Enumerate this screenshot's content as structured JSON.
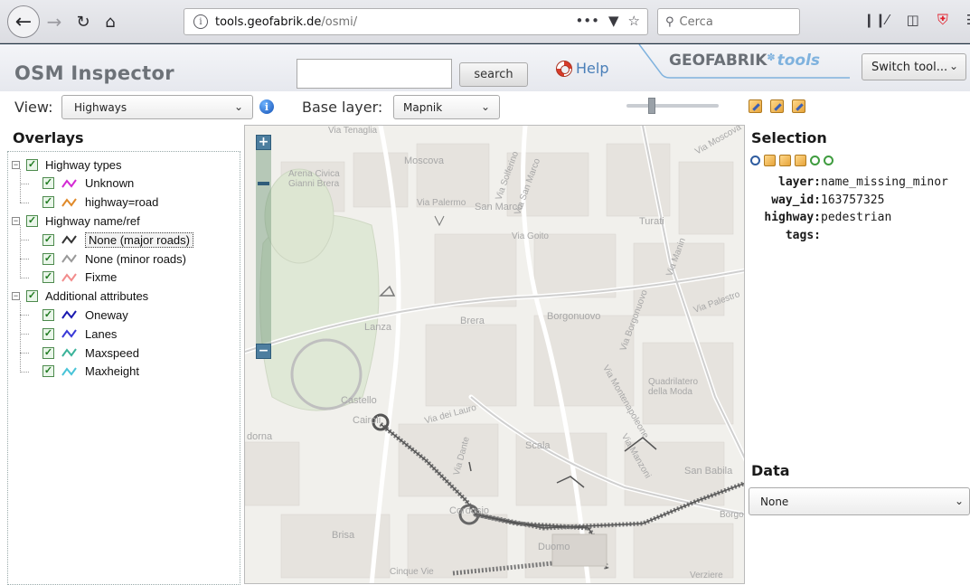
{
  "browser": {
    "url_domain": "tools.geofabrik.de",
    "url_path": "/osmi/",
    "search_placeholder": "Cerca",
    "page_actions_icon": "•••"
  },
  "header": {
    "title": "OSM Inspector",
    "search_value": "",
    "search_button": "search",
    "help_label": "Help",
    "brand_name": "GEOFABRIK",
    "brand_suffix": "tools",
    "switch_tool": "Switch tool..."
  },
  "controls": {
    "view_label": "View:",
    "view_value": "Highways",
    "base_label": "Base layer:",
    "base_value": "Mapnik",
    "opacity_level": 0.25
  },
  "overlays": {
    "title": "Overlays",
    "groups": [
      {
        "label": "Highway types",
        "checked": true,
        "items": [
          {
            "label": "Unknown",
            "checked": true,
            "color": "#d42ad4"
          },
          {
            "label": "highway=road",
            "checked": true,
            "color": "#e08a2a"
          }
        ]
      },
      {
        "label": "Highway name/ref",
        "checked": true,
        "items": [
          {
            "label": "None (major roads)",
            "checked": true,
            "color": "#333333",
            "selected": true
          },
          {
            "label": "None (minor roads)",
            "checked": true,
            "color": "#999999"
          },
          {
            "label": "Fixme",
            "checked": true,
            "color": "#f28c8c"
          }
        ]
      },
      {
        "label": "Additional attributes",
        "checked": true,
        "items": [
          {
            "label": "Oneway",
            "checked": true,
            "color": "#1a1ab0"
          },
          {
            "label": "Lanes",
            "checked": true,
            "color": "#3a3ad8"
          },
          {
            "label": "Maxspeed",
            "checked": true,
            "color": "#3bb39a"
          },
          {
            "label": "Maxheight",
            "checked": true,
            "color": "#49c4d8"
          }
        ]
      }
    ]
  },
  "map": {
    "labels": [
      "Moscova",
      "Arena Civica Gianni Brera",
      "Via Palermo",
      "San Marco",
      "Via Solferino",
      "Via San Marco",
      "Via Goito",
      "Turati",
      "Via Manin",
      "Via Palestro",
      "Lanza",
      "Brera",
      "Borgonuovo",
      "Via Borgonuovo",
      "Castello",
      "Cairoli",
      "Via dei Lauro",
      "Scala",
      "Via Montenapoleone",
      "Quadrilatero della Moda",
      "San Babila",
      "Cordusio",
      "Via Dante",
      "Brisa",
      "Duomo",
      "Cinque Vie",
      "Via Manzoni",
      "Verziere",
      "Via Moscova",
      "Via Tenaglia",
      "dorna",
      "Borgo"
    ]
  },
  "selection": {
    "title": "Selection",
    "fields": [
      {
        "key": "layer:",
        "value": "name_missing_minor"
      },
      {
        "key": "way_id:",
        "value": "163757325"
      },
      {
        "key": "highway:",
        "value": "pedestrian"
      },
      {
        "key": "tags:",
        "value": ""
      }
    ]
  },
  "data_panel": {
    "title": "Data",
    "value": "None"
  }
}
